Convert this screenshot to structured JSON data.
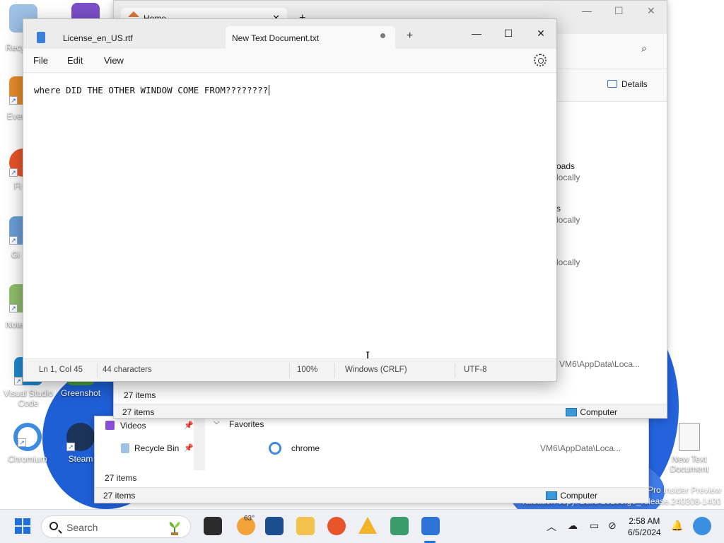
{
  "desktop": {
    "icons": [
      {
        "label": "Visual Studio Code"
      },
      {
        "label": "Greenshot"
      },
      {
        "label": "Chromium"
      },
      {
        "label": "Steam"
      },
      {
        "label": "New Text Document"
      }
    ],
    "partial_labels": [
      "Recy",
      "Ever",
      "Fi",
      "Gi",
      "Note"
    ],
    "watermark": {
      "line1": "Pro Insider Preview",
      "line2": "Evaluation copy. Build 26100.ge_release.240308-1400"
    }
  },
  "explorer_front": {
    "tab_title": "Home",
    "details_label": "Details",
    "rows": [
      {
        "name": "oads",
        "status": "locally"
      },
      {
        "name": "s",
        "status": "locally"
      },
      {
        "name": "",
        "status": "locally"
      },
      {
        "name": "",
        "status": "VM6\\AppData\\Loca..."
      }
    ],
    "inner_status": "27 items",
    "status_count": "27 items",
    "status_location": "Computer"
  },
  "explorer_back": {
    "nav_items": [
      {
        "label": "Videos"
      },
      {
        "label": "Recycle Bin"
      }
    ],
    "group_header": "Favorites",
    "rows": [
      {
        "name": "chrome",
        "location": "VM6\\AppData\\Loca..."
      }
    ],
    "inner_status": "27 items",
    "status_count": "27 items",
    "status_location": "Computer"
  },
  "notepad": {
    "tabs": [
      {
        "label": "License_en_US.rtf",
        "active": false
      },
      {
        "label": "New Text Document.txt",
        "active": true,
        "unsaved": true
      }
    ],
    "menu": [
      "File",
      "Edit",
      "View"
    ],
    "editor_text": "where DID THE OTHER WINDOW COME FROM????????",
    "status": {
      "position": "Ln 1, Col 45",
      "characters": "44 characters",
      "zoom": "100%",
      "line_ending": "Windows (CRLF)",
      "encoding": "UTF-8"
    }
  },
  "taskbar": {
    "search_placeholder": "Search",
    "weather_temp": "63°",
    "time": "2:58 AM",
    "date": "6/5/2024"
  }
}
